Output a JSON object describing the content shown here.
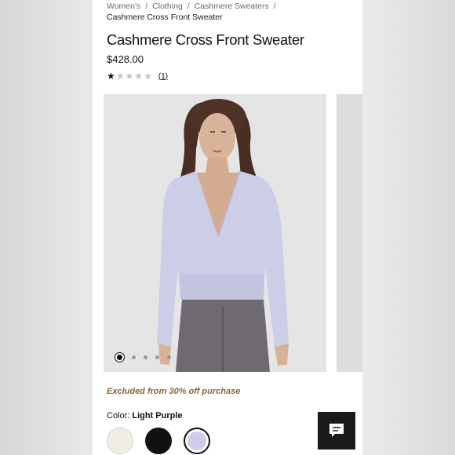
{
  "breadcrumb": {
    "items": [
      "Women's",
      "Clothing",
      "Cashmere Sweaters"
    ],
    "separator": "/",
    "current": "Cashmere Cross Front Sweater"
  },
  "product": {
    "title": "Cashmere Cross Front Sweater",
    "price": "$428.00",
    "rating": {
      "stars_filled": 1,
      "stars_total": 5,
      "review_count": "(1)"
    },
    "promo": "Excluded from 30% off purchase",
    "color": {
      "label": "Color:",
      "selected": "Light Purple"
    },
    "swatches": [
      {
        "name": "cream",
        "hex": "#efede6"
      },
      {
        "name": "black",
        "hex": "#111111"
      },
      {
        "name": "light-purple",
        "hex": "#cfcde9",
        "selected": true
      }
    ]
  },
  "gallery": {
    "image_count": 5,
    "active_index": 0
  },
  "icons": {
    "chat": "chat-bubble-icon",
    "star": "star-icon"
  },
  "colors": {
    "promo": "#8a6a3a",
    "accent": "#1a1a1a"
  }
}
